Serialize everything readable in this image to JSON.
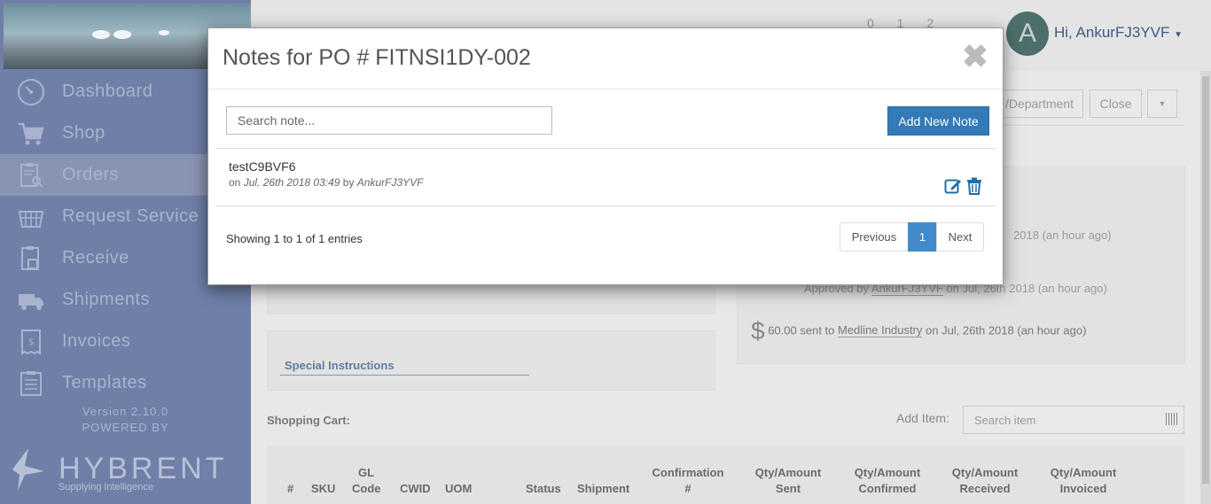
{
  "sidebar": {
    "items": [
      {
        "label": "Dashboard",
        "icon": "dashboard-gauge-icon"
      },
      {
        "label": "Shop",
        "icon": "cart-icon"
      },
      {
        "label": "Orders",
        "icon": "clipboard-search-icon"
      },
      {
        "label": "Request Service",
        "icon": "basket-icon"
      },
      {
        "label": "Receive",
        "icon": "receive-box-icon"
      },
      {
        "label": "Shipments",
        "icon": "truck-icon"
      },
      {
        "label": "Invoices",
        "icon": "invoice-icon"
      },
      {
        "label": "Templates",
        "icon": "template-icon"
      }
    ],
    "active_item": "Orders",
    "version": "Version 2.10.0",
    "powered_by": "POWERED BY",
    "brand_name": "HYBRENT",
    "brand_tagline": "Supplying Intelligence"
  },
  "header": {
    "avatar_letter": "A",
    "greeting": "Hi, AnkurFJ3YVF",
    "counters": "0 1 2"
  },
  "background": {
    "toolbar_buttons": [
      "/Department",
      "Close"
    ],
    "activity": [
      {
        "text_prefix": "",
        "text": "2018 (an hour ago)"
      },
      {
        "text_prefix": "Approved by ",
        "user": "AnkurFJ3YVF",
        "text": " on Jul, 26th 2018 (an hour ago)"
      },
      {
        "amount": "60.00",
        "text_mid": " sent to ",
        "vendor": "Medline Industry",
        "text": " on Jul, 26th 2018 (an hour ago)"
      }
    ],
    "special_instructions": "Special Instructions",
    "shopping_cart_label": "Shopping Cart:",
    "add_item_label": "Add Item:",
    "search_item_placeholder": "Search item",
    "table_columns": [
      "#",
      "SKU",
      "GL Code",
      "CWID",
      "UOM",
      "Status",
      "Shipment",
      "Confirmation #",
      "Qty/Amount Sent",
      "Qty/Amount Confirmed",
      "Qty/Amount Received",
      "Qty/Amount Invoiced"
    ]
  },
  "modal": {
    "title": "Notes for PO # FITNSI1DY-002",
    "close_glyph": "✖",
    "search_placeholder": "Search note...",
    "add_button": "Add New Note",
    "notes": [
      {
        "text": "testC9BVF6",
        "meta_prefix": "on ",
        "date": "Jul, 26th 2018 03:49",
        "meta_by": " by ",
        "author": "AnkurFJ3YVF"
      }
    ],
    "info": "Showing 1 to 1 of 1 entries",
    "pagination": {
      "previous": "Previous",
      "current": "1",
      "next": "Next"
    }
  },
  "colors": {
    "primary": "#337ab7",
    "sidebar": "#6f7fa8"
  }
}
